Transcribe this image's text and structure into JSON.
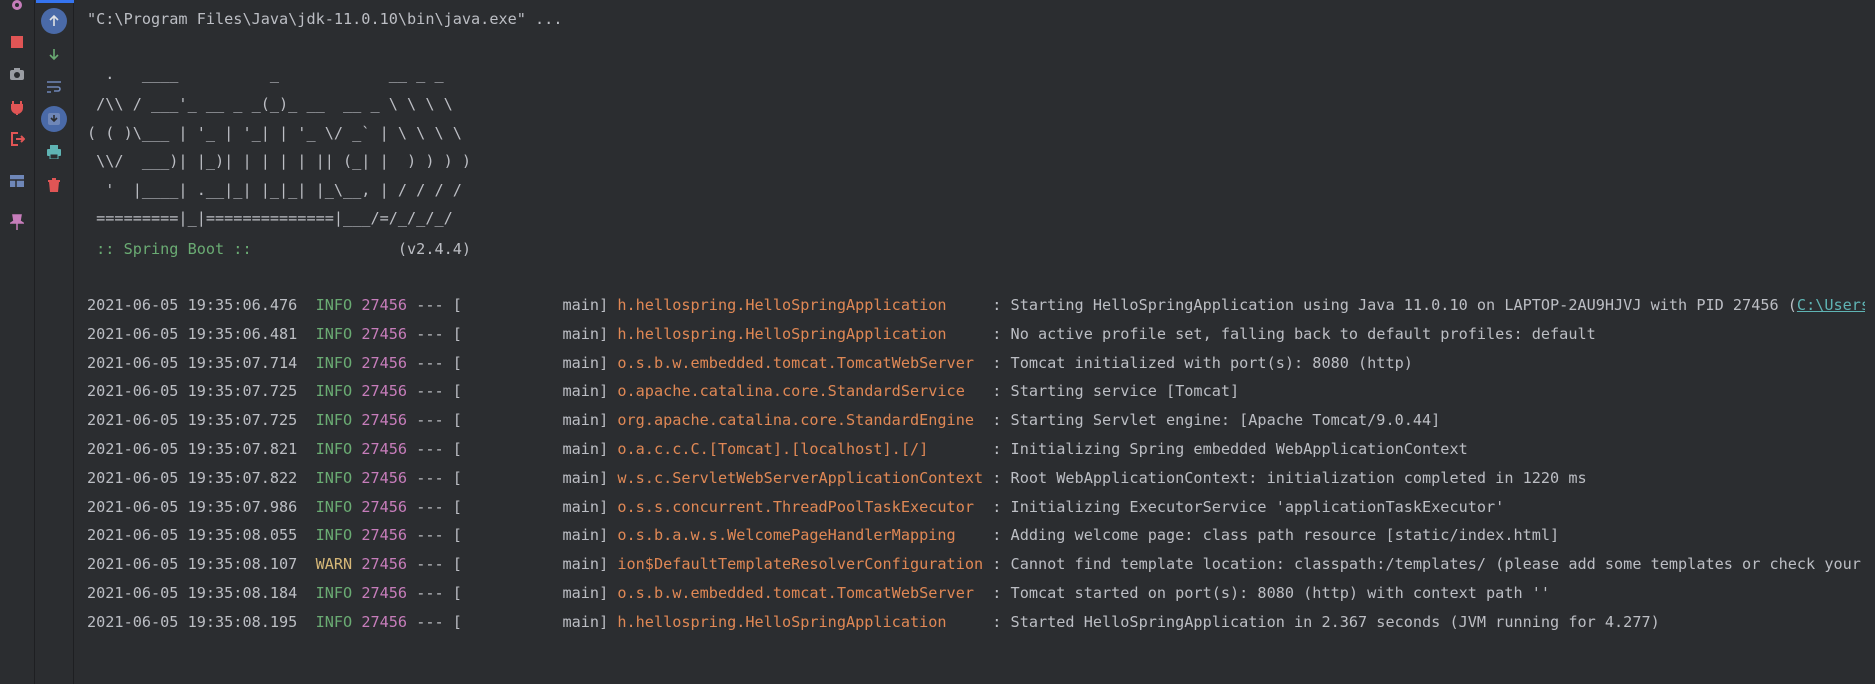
{
  "command_line": "\"C:\\Program Files\\Java\\jdk-11.0.10\\bin\\java.exe\" ...",
  "banner": [
    "  .   ____          _            __ _ _",
    " /\\\\ / ___'_ __ _ _(_)_ __  __ _ \\ \\ \\ \\",
    "( ( )\\___ | '_ | '_| | '_ \\/ _` | \\ \\ \\ \\",
    " \\\\/  ___)| |_)| | | | | || (_| |  ) ) ) )",
    "  '  |____| .__|_| |_|_| |_\\__, | / / / /",
    " =========|_|==============|___/=/_/_/_/"
  ],
  "spring_label": " :: Spring Boot :: ",
  "spring_version": "               (v2.4.4)",
  "log_lines": [
    {
      "ts": "2021-06-05 19:35:06.476",
      "level": "INFO",
      "pid": "27456",
      "sep": " --- [           main] ",
      "logger": "h.hellospring.HelloSpringApplication    ",
      "msg": " : Starting HelloSpringApplication using Java 11.0.10 on LAPTOP-2AU9HJVJ with PID 27456 (",
      "link": "C:\\Users\\"
    },
    {
      "ts": "2021-06-05 19:35:06.481",
      "level": "INFO",
      "pid": "27456",
      "sep": " --- [           main] ",
      "logger": "h.hellospring.HelloSpringApplication    ",
      "msg": " : No active profile set, falling back to default profiles: default",
      "link": ""
    },
    {
      "ts": "2021-06-05 19:35:07.714",
      "level": "INFO",
      "pid": "27456",
      "sep": " --- [           main] ",
      "logger": "o.s.b.w.embedded.tomcat.TomcatWebServer ",
      "msg": " : Tomcat initialized with port(s): 8080 (http)",
      "link": ""
    },
    {
      "ts": "2021-06-05 19:35:07.725",
      "level": "INFO",
      "pid": "27456",
      "sep": " --- [           main] ",
      "logger": "o.apache.catalina.core.StandardService  ",
      "msg": " : Starting service [Tomcat]",
      "link": ""
    },
    {
      "ts": "2021-06-05 19:35:07.725",
      "level": "INFO",
      "pid": "27456",
      "sep": " --- [           main] ",
      "logger": "org.apache.catalina.core.StandardEngine ",
      "msg": " : Starting Servlet engine: [Apache Tomcat/9.0.44]",
      "link": ""
    },
    {
      "ts": "2021-06-05 19:35:07.821",
      "level": "INFO",
      "pid": "27456",
      "sep": " --- [           main] ",
      "logger": "o.a.c.c.C.[Tomcat].[localhost].[/]      ",
      "msg": " : Initializing Spring embedded WebApplicationContext",
      "link": ""
    },
    {
      "ts": "2021-06-05 19:35:07.822",
      "level": "INFO",
      "pid": "27456",
      "sep": " --- [           main] ",
      "logger": "w.s.c.ServletWebServerApplicationContext",
      "msg": " : Root WebApplicationContext: initialization completed in 1220 ms",
      "link": ""
    },
    {
      "ts": "2021-06-05 19:35:07.986",
      "level": "INFO",
      "pid": "27456",
      "sep": " --- [           main] ",
      "logger": "o.s.s.concurrent.ThreadPoolTaskExecutor ",
      "msg": " : Initializing ExecutorService 'applicationTaskExecutor'",
      "link": ""
    },
    {
      "ts": "2021-06-05 19:35:08.055",
      "level": "INFO",
      "pid": "27456",
      "sep": " --- [           main] ",
      "logger": "o.s.b.a.w.s.WelcomePageHandlerMapping   ",
      "msg": " : Adding welcome page: class path resource [static/index.html]",
      "link": ""
    },
    {
      "ts": "2021-06-05 19:35:08.107",
      "level": "WARN",
      "pid": "27456",
      "sep": " --- [           main] ",
      "logger": "ion$DefaultTemplateResolverConfiguration",
      "msg": " : Cannot find template location: classpath:/templates/ (please add some templates or check your Th",
      "link": ""
    },
    {
      "ts": "2021-06-05 19:35:08.184",
      "level": "INFO",
      "pid": "27456",
      "sep": " --- [           main] ",
      "logger": "o.s.b.w.embedded.tomcat.TomcatWebServer ",
      "msg": " : Tomcat started on port(s): 8080 (http) with context path ''",
      "link": ""
    },
    {
      "ts": "2021-06-05 19:35:08.195",
      "level": "INFO",
      "pid": "27456",
      "sep": " --- [           main] ",
      "logger": "h.hellospring.HelloSpringApplication    ",
      "msg": " : Started HelloSpringApplication in 2.367 seconds (JVM running for 4.277)",
      "link": ""
    }
  ],
  "left_icons": [
    "settings-icon",
    "stop-icon",
    "camera-icon",
    "plug-icon",
    "exit-icon",
    "layout-icon",
    "pin-icon"
  ],
  "tool_icons": [
    "scroll-up-icon",
    "scroll-down-icon",
    "soft-wrap-icon",
    "scroll-to-end-icon",
    "print-icon",
    "trash-icon"
  ],
  "colors": {
    "info": "#6aab73",
    "warn": "#d5b778",
    "pid": "#c77dbb",
    "logger": "#e08855",
    "link": "#5fb4b4"
  }
}
